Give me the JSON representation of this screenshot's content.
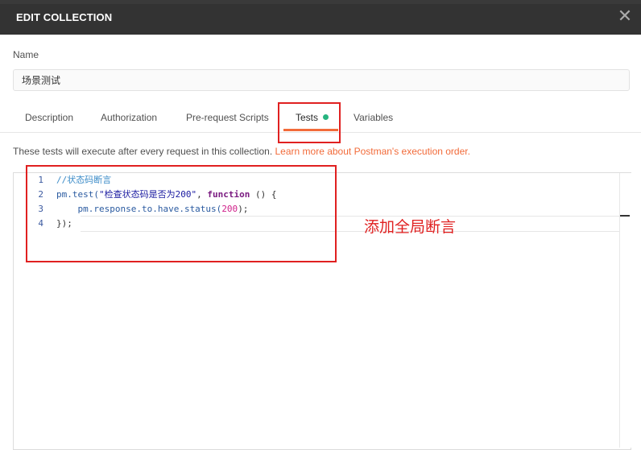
{
  "dialog": {
    "title": "EDIT COLLECTION",
    "close_icon": "close-icon"
  },
  "name": {
    "label": "Name",
    "value": "场景测试"
  },
  "tabs": [
    {
      "label": "Description"
    },
    {
      "label": "Authorization"
    },
    {
      "label": "Pre-request Scripts"
    },
    {
      "label": "Tests",
      "active": true,
      "has_content_dot": true
    },
    {
      "label": "Variables"
    }
  ],
  "tests": {
    "description": "These tests will execute after every request in this collection.",
    "learn_more": "Learn more about Postman's execution order."
  },
  "editor": {
    "line_numbers": [
      "1",
      "2",
      "3",
      "4"
    ],
    "line1": {
      "comment": "//状态码断言"
    },
    "line2": {
      "a": "pm.test(",
      "str": "\"检查状态码是否为200\"",
      "b": ", ",
      "kw": "function",
      "c": " () {"
    },
    "line3": {
      "a": "    pm.response.to.have.status(",
      "num": "200",
      "b": ");"
    },
    "line4": {
      "a": "});"
    }
  },
  "annotation": "添加全局断言",
  "colors": {
    "titlebar": "#333333",
    "accent": "#f26b3a",
    "dot": "#26b47f",
    "annotation_red": "#e02020"
  }
}
